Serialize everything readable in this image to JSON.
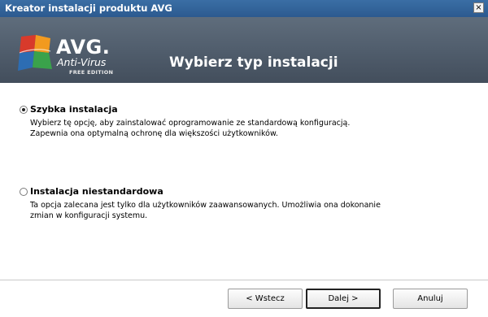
{
  "window": {
    "title": "Kreator instalacji produktu AVG",
    "close_symbol": "×"
  },
  "header": {
    "brand": "AVG.",
    "product": "Anti-Virus",
    "edition": "FREE EDITION",
    "heading": "Wybierz typ instalacji",
    "logo_icon": "avg-logo-icon",
    "colors": {
      "header_bg": "#4f5c6b",
      "logo_red": "#d83a2b",
      "logo_orange": "#f29a1f",
      "logo_blue": "#2d6db3",
      "logo_green": "#3aa24b"
    }
  },
  "options": [
    {
      "label": "Szybka instalacja",
      "selected": true,
      "description_lines": [
        "Wybierz tę opcję, aby zainstalować oprogramowanie ze standardową konfiguracją.",
        "Zapewnia ona optymalną ochronę dla większości użytkowników."
      ]
    },
    {
      "label": "Instalacja niestandardowa",
      "selected": false,
      "description_lines": [
        "Ta opcja zalecana jest tylko dla użytkowników zaawansowanych. Umożliwia ona dokonanie",
        "zmian w konfiguracji systemu."
      ]
    }
  ],
  "buttons": {
    "back": "< Wstecz",
    "next": "Dalej >",
    "cancel": "Anuluj"
  }
}
